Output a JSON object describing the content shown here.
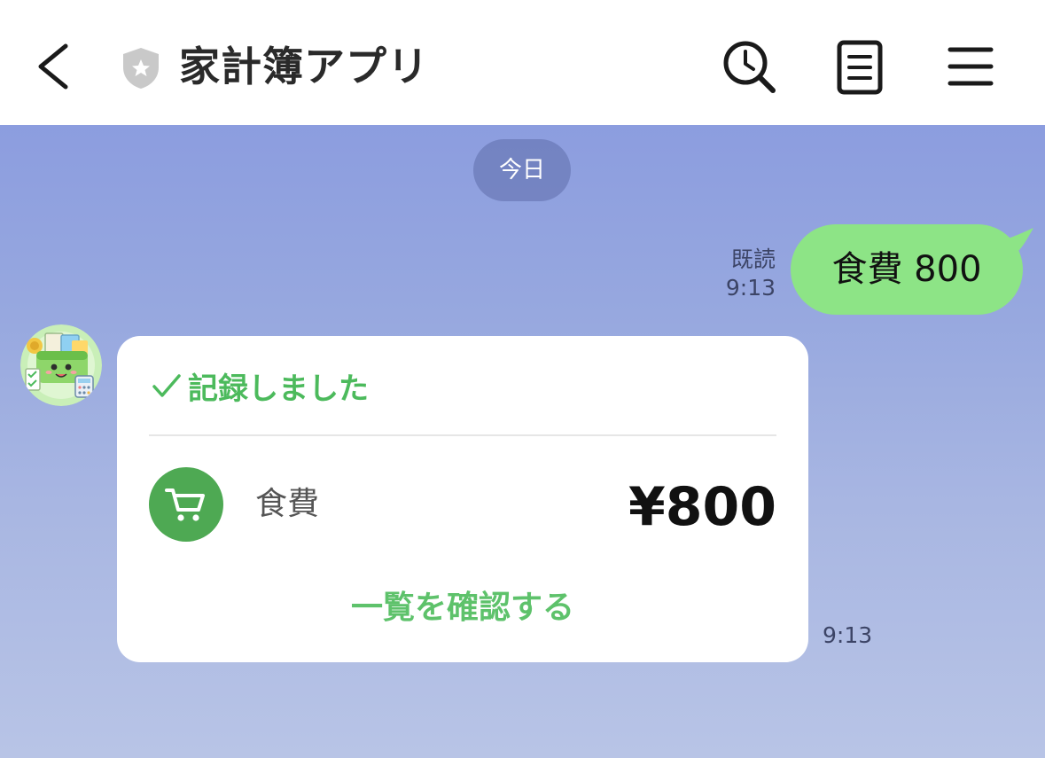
{
  "header": {
    "title": "家計簿アプリ",
    "icons": [
      "back-icon",
      "shield-icon",
      "search-icon",
      "notes-icon",
      "menu-icon"
    ]
  },
  "chat": {
    "date_label": "今日",
    "outgoing": {
      "read_label": "既読",
      "time": "9:13",
      "text": "食費 800",
      "bubble_color": "#8de486"
    },
    "incoming": {
      "status": "記録しました",
      "category": "食費",
      "amount": "¥800",
      "link_label": "一覧を確認する",
      "time": "9:13",
      "accent_color": "#4cba5c",
      "icon": "cart-icon"
    }
  }
}
